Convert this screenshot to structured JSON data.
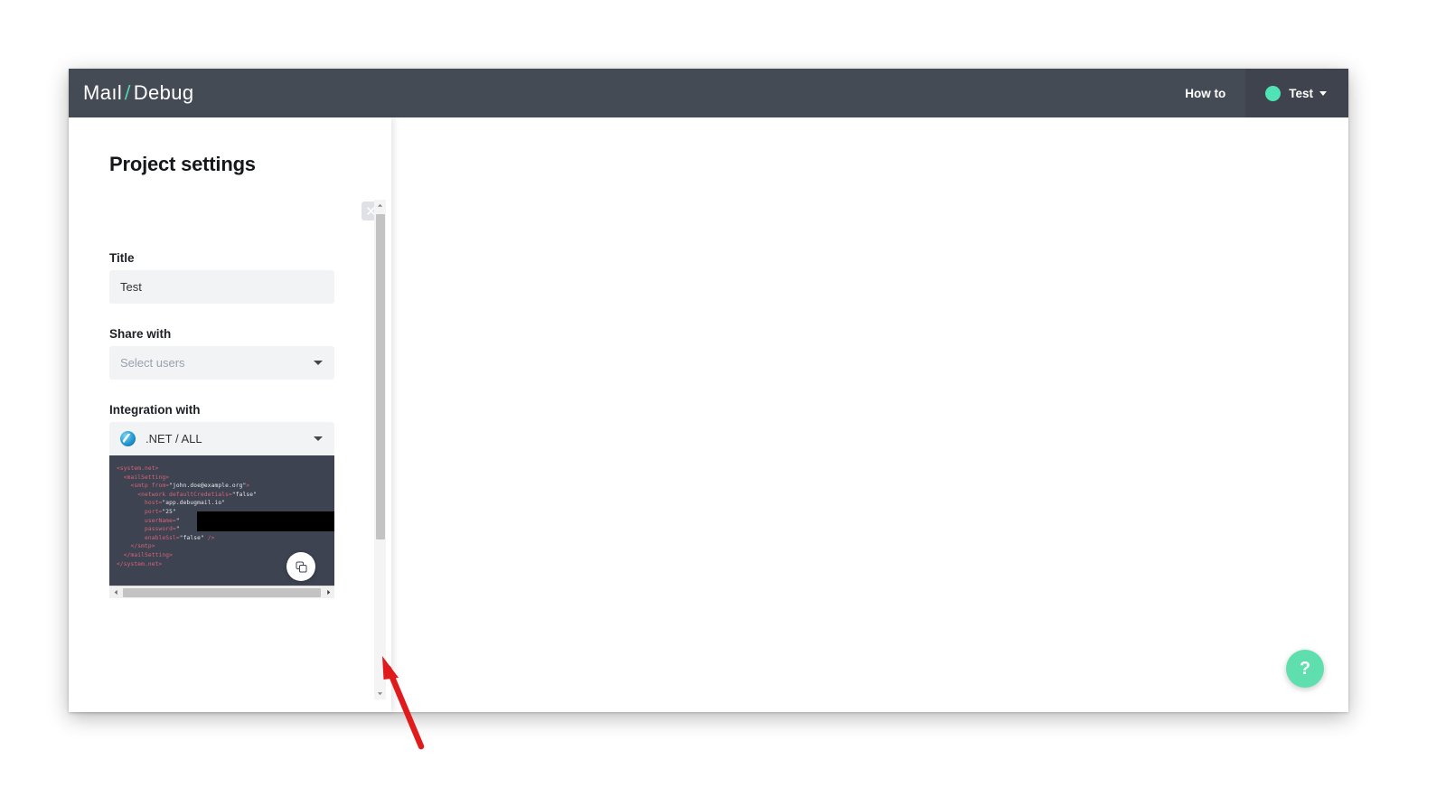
{
  "header": {
    "logo_main": "Ma",
    "logo_main2": "ıl",
    "logo_slash": "/",
    "logo_secondary": "Debug",
    "howto_label": "How to",
    "username": "Test",
    "avatar_icon": "avatar-circle-icon",
    "caret_icon": "chevron-down-icon"
  },
  "panel": {
    "title": "Project settings",
    "close_icon": "close-icon",
    "fields": {
      "title_label": "Title",
      "title_value": "Test",
      "share_label": "Share with",
      "share_placeholder": "Select users",
      "integration_label": "Integration with",
      "integration_value": ".NET / ALL",
      "integration_icon": "dotnet-logo-icon",
      "select_caret_icon": "caret-down-icon"
    },
    "code": {
      "language": ".NET",
      "copy_icon": "copy-icon",
      "content": "<system.net>\n  <mailSetting>\n    <smtp from=\"john.doe@example.org\">\n      <network defaultCredetials=\"false\"\n        host=\"app.debugmail.io\"\n        port=\"25\"\n        userName=\"\n        password=\"\n        enableSsl=\"false\" />\n    </smtp>\n  </mailSetting>\n</system.net>",
      "redacted": true
    },
    "scrollbar": {
      "h_left_icon": "scroll-left-arrow-icon",
      "h_right_icon": "scroll-right-arrow-icon",
      "v_up_icon": "scroll-up-arrow-icon",
      "v_down_icon": "scroll-down-arrow-icon"
    }
  },
  "annotation": {
    "arrow_color": "#e01b1b",
    "arrow_icon": "annotation-arrow-icon"
  },
  "help": {
    "label": "?",
    "icon": "help-question-icon",
    "color": "#5fdfae"
  },
  "colors": {
    "header_bg": "#454b55",
    "usermenu_bg": "#3e434d",
    "accent_teal": "#56d6b0",
    "code_bg": "#3d4350",
    "code_tag": "#d9657a",
    "field_bg": "#f2f3f5"
  }
}
